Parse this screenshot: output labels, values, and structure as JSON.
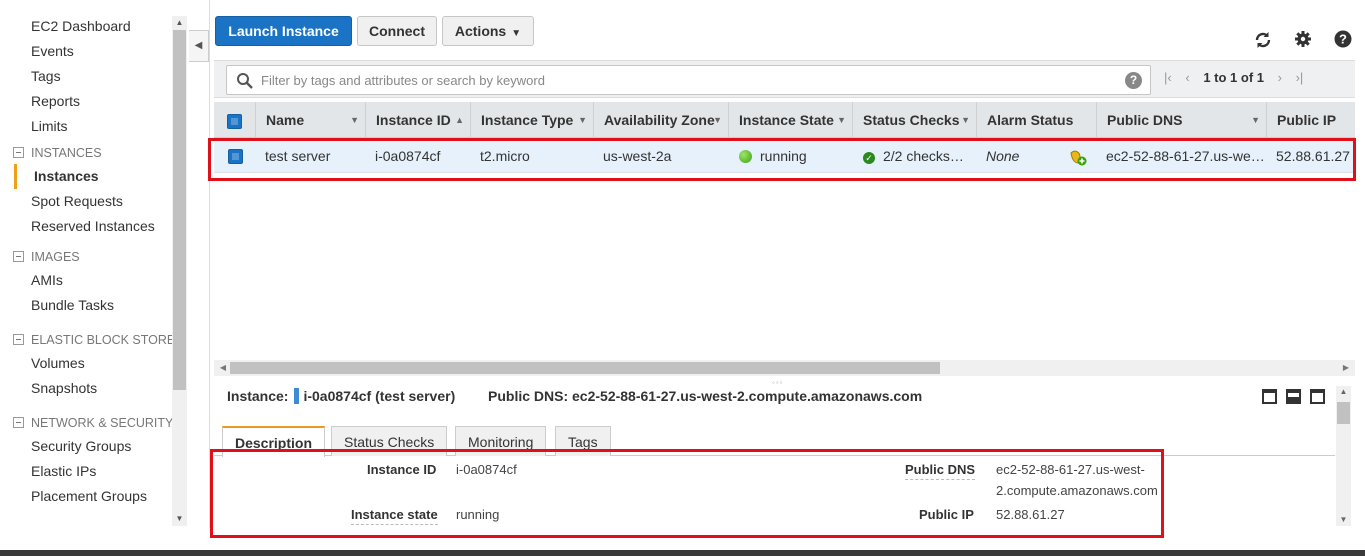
{
  "sidebar": {
    "items": [
      {
        "type": "item",
        "label": "EC2 Dashboard"
      },
      {
        "type": "item",
        "label": "Events"
      },
      {
        "type": "item",
        "label": "Tags"
      },
      {
        "type": "item",
        "label": "Reports"
      },
      {
        "type": "item",
        "label": "Limits"
      }
    ],
    "section_instances": "INSTANCES",
    "instances_items": [
      "Instances",
      "Spot Requests",
      "Reserved Instances"
    ],
    "section_images": "IMAGES",
    "images_items": [
      "AMIs",
      "Bundle Tasks"
    ],
    "section_ebs": "ELASTIC BLOCK STORE",
    "ebs_items": [
      "Volumes",
      "Snapshots"
    ],
    "section_network": "NETWORK & SECURITY",
    "network_items": [
      "Security Groups",
      "Elastic IPs",
      "Placement Groups"
    ],
    "active_item": "Instances"
  },
  "toolbar": {
    "launch_label": "Launch Instance",
    "connect_label": "Connect",
    "actions_label": "Actions"
  },
  "search": {
    "placeholder": "Filter by tags and attributes or search by keyword",
    "value": ""
  },
  "pager": {
    "text": "1 to 1 of 1"
  },
  "table": {
    "columns": [
      "Name",
      "Instance ID",
      "Instance Type",
      "Availability Zone",
      "Instance State",
      "Status Checks",
      "Alarm Status",
      "Public DNS",
      "Public IP"
    ],
    "rows": [
      {
        "name": "test server",
        "instance_id": "i-0a0874cf",
        "instance_type": "t2.micro",
        "availability_zone": "us-west-2a",
        "instance_state": "running",
        "status_checks": "2/2 checks…",
        "alarm_status": "None",
        "public_dns": "ec2-52-88-61-27.us-we…",
        "public_ip": "52.88.61.27"
      }
    ]
  },
  "detail": {
    "instance_label": "Instance:",
    "instance_value": "i-0a0874cf (test server)",
    "dns_label": "Public DNS:",
    "dns_value": "ec2-52-88-61-27.us-west-2.compute.amazonaws.com",
    "tabs": [
      "Description",
      "Status Checks",
      "Monitoring",
      "Tags"
    ],
    "fields": {
      "instance_id_label": "Instance ID",
      "instance_id_value": "i-0a0874cf",
      "instance_state_label": "Instance state",
      "instance_state_value": "running",
      "public_dns_label": "Public DNS",
      "public_dns_value_line1": "ec2-52-88-61-27.us-west-",
      "public_dns_value_line2": "2.compute.amazonaws.com",
      "public_ip_label": "Public IP",
      "public_ip_value": "52.88.61.27"
    }
  },
  "colors": {
    "primary": "#1a73c5",
    "highlight_box": "#e0101b",
    "selected_row": "#e6f1fb",
    "active_accent": "#f0a018",
    "running": "#3aa30b"
  }
}
